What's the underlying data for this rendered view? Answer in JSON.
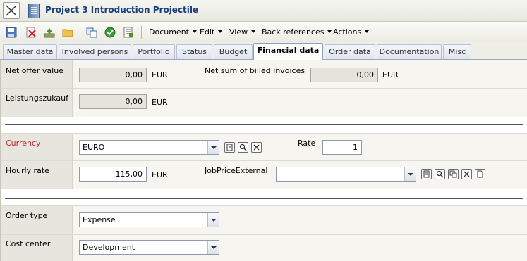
{
  "window": {
    "title": "Project 3 Introduction Projectile"
  },
  "toolbar": {
    "menus": [
      "Document",
      "Edit",
      "View",
      "Back references",
      "Actions"
    ],
    "icons": [
      "save-icon",
      "delete-icon",
      "upload-icon",
      "folder-icon",
      "copy-icon",
      "refresh-check-icon",
      "print-icon"
    ]
  },
  "tabs": [
    {
      "label": "Master data",
      "active": false
    },
    {
      "label": "Involved persons",
      "active": false
    },
    {
      "label": "Portfolio",
      "active": false
    },
    {
      "label": "Status",
      "active": false
    },
    {
      "label": "Budget",
      "active": false
    },
    {
      "label": "Financial data",
      "active": true
    },
    {
      "label": "Order data",
      "active": false
    },
    {
      "label": "Documentation",
      "active": false
    },
    {
      "label": "Misc",
      "active": false
    }
  ],
  "financial": {
    "net_offer_value": {
      "label": "Net offer value",
      "value": "0,00",
      "unit": "EUR"
    },
    "net_sum_billed": {
      "label": "Net sum of billed invoices",
      "value": "0,00",
      "unit": "EUR"
    },
    "leistungszukauf": {
      "label": "Leistungszukauf",
      "value": "0,00",
      "unit": "EUR"
    },
    "currency": {
      "label": "Currency",
      "value": "EURO"
    },
    "rate": {
      "label": "Rate",
      "value": "1"
    },
    "hourly_rate": {
      "label": "Hourly rate",
      "value": "115,00",
      "unit": "EUR"
    },
    "job_price_external": {
      "label": "JobPriceExternal",
      "value": ""
    },
    "order_type": {
      "label": "Order type",
      "value": "Expense"
    },
    "cost_center": {
      "label": "Cost center",
      "value": "Development"
    }
  },
  "colors": {
    "required_label": "#c1272d",
    "title": "#1b3f7a"
  }
}
